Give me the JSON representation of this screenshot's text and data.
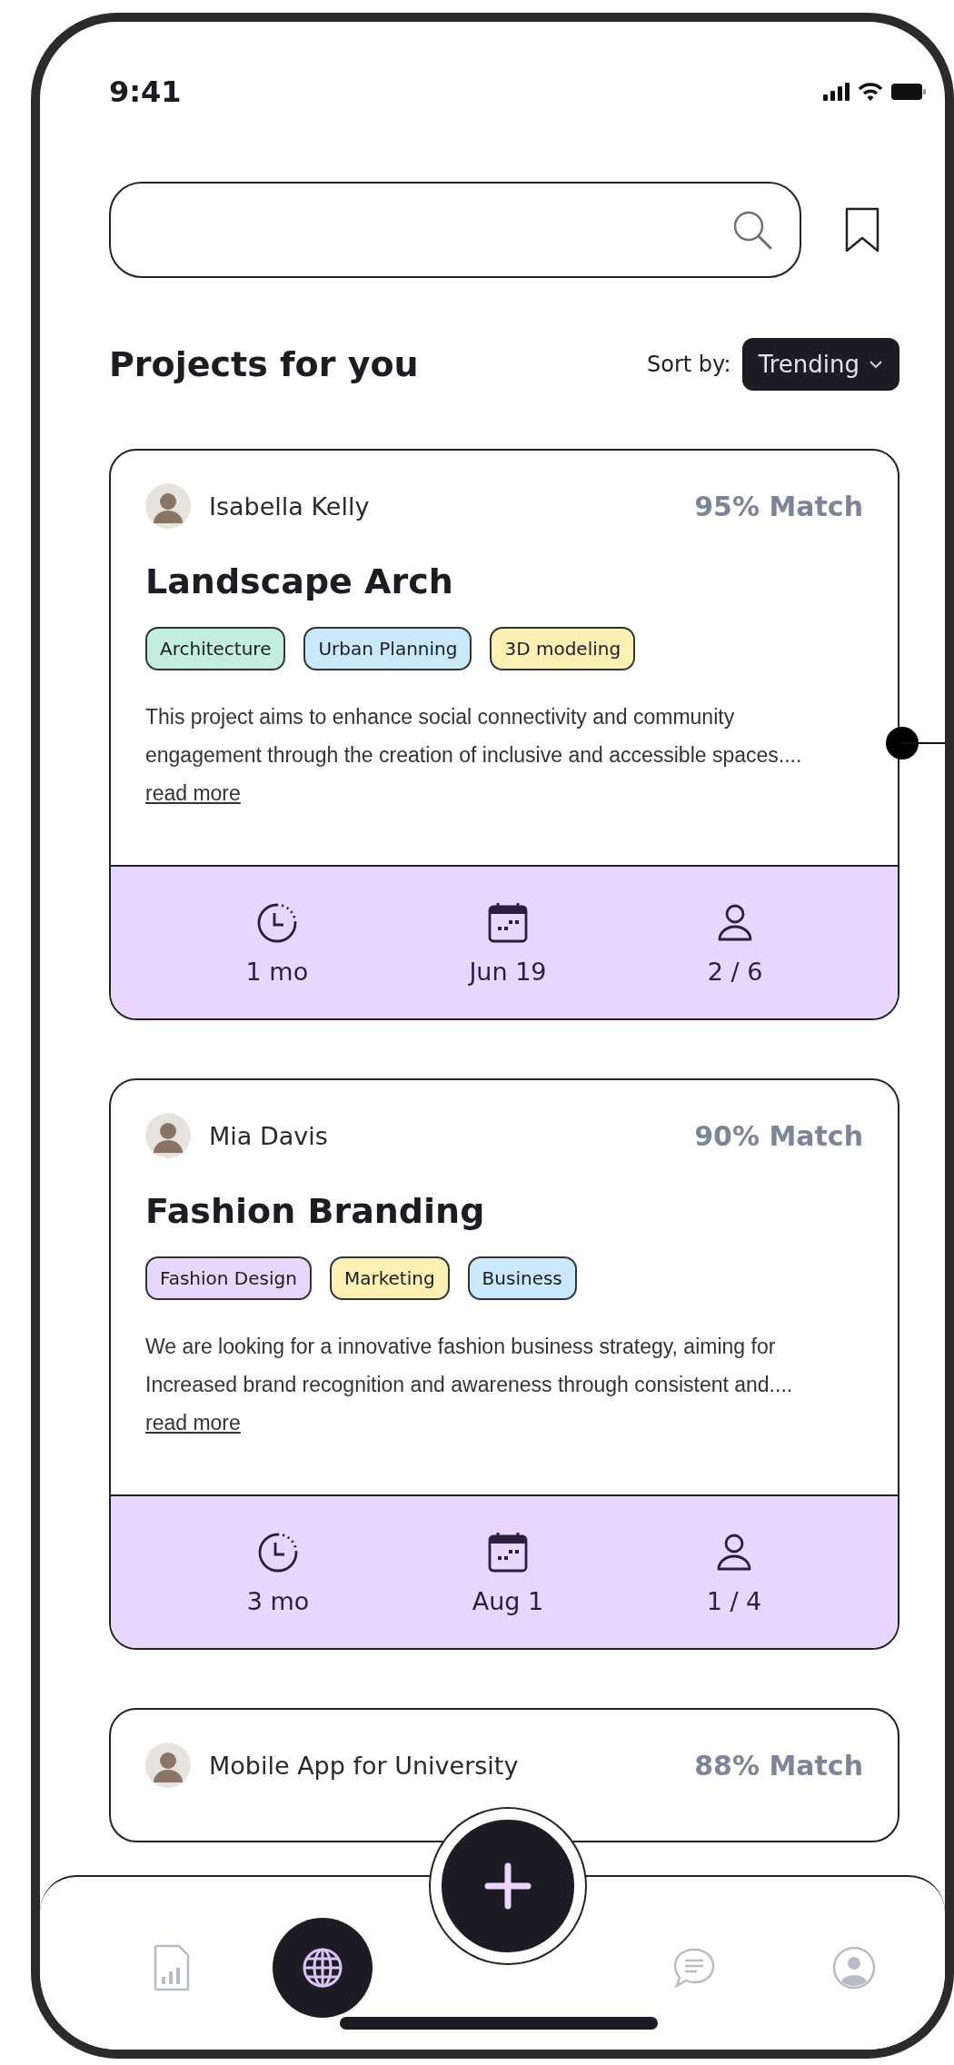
{
  "status_bar": {
    "time": "9:41"
  },
  "heading": "Projects for you",
  "sort": {
    "label": "Sort by:",
    "value": "Trending"
  },
  "projects": [
    {
      "author": "Isabella Kelly",
      "match": "95% Match",
      "title": "Landscape Arch",
      "tags": [
        {
          "label": "Architecture",
          "color": "#c3eedf"
        },
        {
          "label": "Urban Planning",
          "color": "#c9e9fb"
        },
        {
          "label": "3D modeling",
          "color": "#fcf0b5"
        }
      ],
      "description": "This project aims to enhance social connectivity and community engagement through the creation of inclusive and accessible spaces....",
      "link": "read more",
      "duration": "1 mo",
      "date": "Jun 19",
      "members": "2 / 6"
    },
    {
      "author": "Mia Davis",
      "match": "90% Match",
      "title": "Fashion Branding",
      "tags": [
        {
          "label": "Fashion Design",
          "color": "#e8d7fb"
        },
        {
          "label": "Marketing",
          "color": "#fcf0b5"
        },
        {
          "label": "Business",
          "color": "#c9e9fb"
        }
      ],
      "description": "We are looking for a innovative fashion business strategy, aiming for Increased brand recognition and awareness through consistent and....",
      "link": "read more",
      "duration": "3 mo",
      "date": "Aug 1",
      "members": "1 / 4"
    },
    {
      "author": "Mobile App for University",
      "match": "88% Match"
    }
  ],
  "nav": [
    {
      "kind": "reports",
      "selected": false
    },
    {
      "kind": "explore",
      "selected": true
    },
    {
      "kind": "add",
      "selected": false
    },
    {
      "kind": "chat",
      "selected": false
    },
    {
      "kind": "profile",
      "selected": false
    }
  ]
}
